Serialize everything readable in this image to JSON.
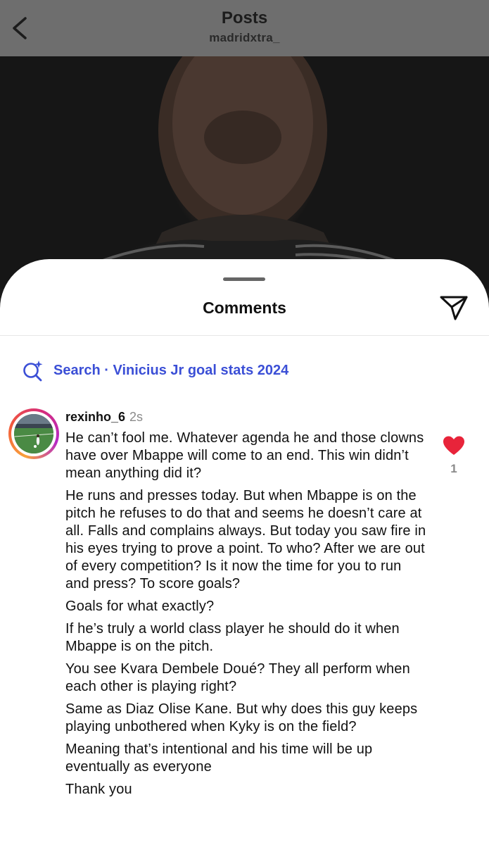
{
  "header": {
    "title": "Posts",
    "subtitle": "madridxtra_",
    "back_icon": "chevron-left-icon"
  },
  "sheet": {
    "title": "Comments",
    "share_icon": "send-icon",
    "search": {
      "icon": "sparkle-search-icon",
      "label": "Search · Vinicius Jr goal stats 2024",
      "color": "#3b4fd6"
    }
  },
  "comment": {
    "username": "rexinho_6",
    "time": "2s",
    "paragraphs": [
      "He can’t fool me. Whatever agenda he and those clowns have over Mbappe will come to an end. This win didn’t mean anything did it?",
      "He runs and presses today. But when Mbappe is on the pitch he refuses to do that and seems he doesn’t care at all. Falls and complains always. But today you saw fire in his eyes trying to prove a point. To who? After we are out of every competition? Is it now the time for you to run and press? To score goals?",
      "Goals for what exactly?",
      "If he’s truly a world class player he should do it when Mbappe is on the pitch.",
      "You see Kvara Dembele Doué? They all perform when each other is playing right?",
      "Same as Diaz Olise Kane. But why does this guy keeps playing unbothered when Kyky is on the field?",
      "Meaning that’s intentional and his time will be up eventually as everyone",
      "Thank you"
    ],
    "like_count": "1",
    "like_icon": "heart-icon",
    "like_color": "#e8243a"
  }
}
